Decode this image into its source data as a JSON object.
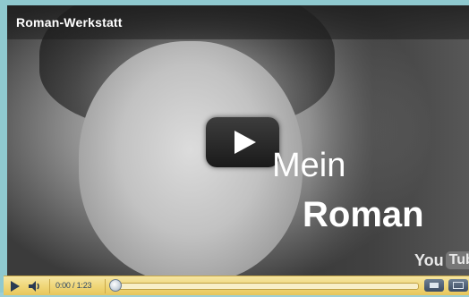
{
  "window": {
    "title": "Roman-Werkstatt"
  },
  "overlay": {
    "line1": "Mein",
    "line2": "Roman"
  },
  "branding": {
    "logo_you": "You",
    "logo_tube": "Tube"
  },
  "controls": {
    "time": "0:00 / 1:23",
    "progress": 0.0
  },
  "colors": {
    "accent_bar": "#f0d77a",
    "frame": "#8fc9cf",
    "control_icon": "#2a3a52"
  }
}
